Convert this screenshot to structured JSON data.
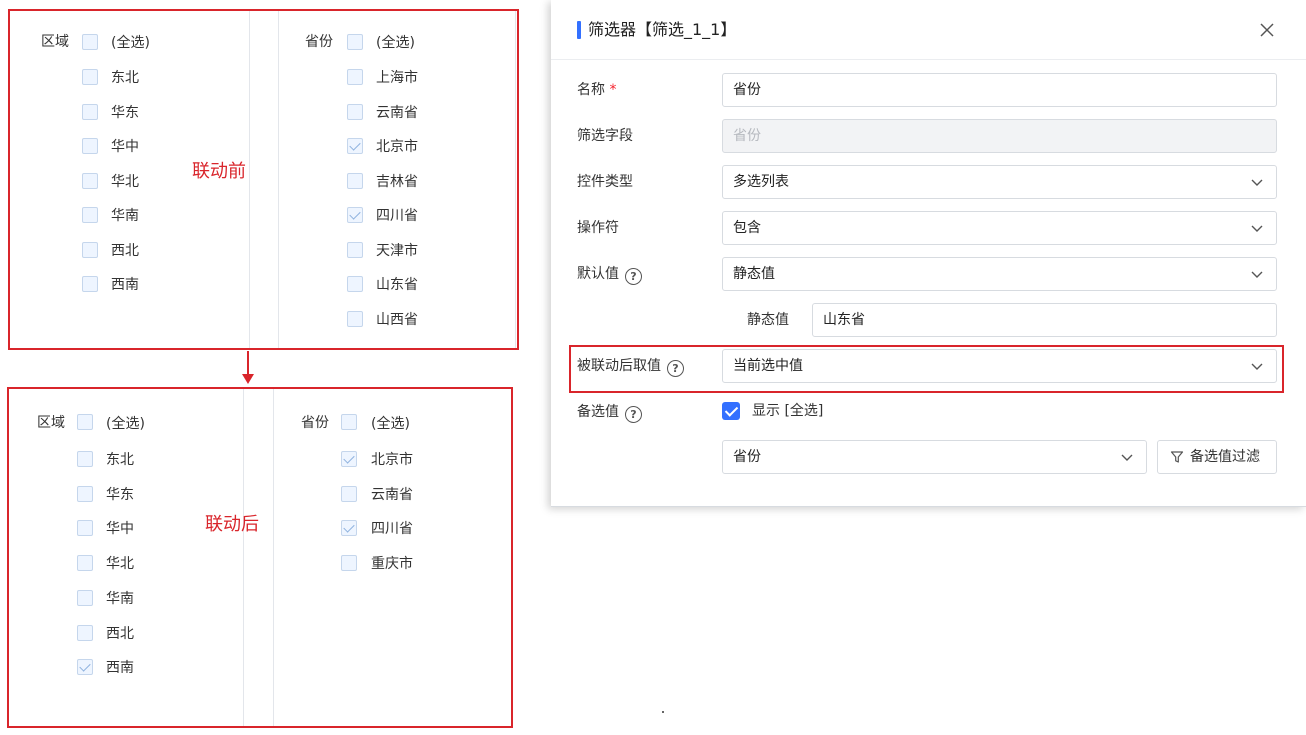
{
  "before": {
    "note": "联动前",
    "region": {
      "header": "区域",
      "select_all": "(全选)",
      "items": [
        {
          "label": "东北",
          "checked": false
        },
        {
          "label": "华东",
          "checked": false
        },
        {
          "label": "华中",
          "checked": false
        },
        {
          "label": "华北",
          "checked": false
        },
        {
          "label": "华南",
          "checked": false
        },
        {
          "label": "西北",
          "checked": false
        },
        {
          "label": "西南",
          "checked": false
        }
      ]
    },
    "province": {
      "header": "省份",
      "select_all": "(全选)",
      "items": [
        {
          "label": "上海市",
          "checked": false
        },
        {
          "label": "云南省",
          "checked": false
        },
        {
          "label": "北京市",
          "checked": true
        },
        {
          "label": "吉林省",
          "checked": false
        },
        {
          "label": "四川省",
          "checked": true
        },
        {
          "label": "天津市",
          "checked": false
        },
        {
          "label": "山东省",
          "checked": false
        },
        {
          "label": "山西省",
          "checked": false
        }
      ]
    }
  },
  "after": {
    "note": "联动后",
    "region": {
      "header": "区域",
      "select_all": "(全选)",
      "items": [
        {
          "label": "东北",
          "checked": false
        },
        {
          "label": "华东",
          "checked": false
        },
        {
          "label": "华中",
          "checked": false
        },
        {
          "label": "华北",
          "checked": false
        },
        {
          "label": "华南",
          "checked": false
        },
        {
          "label": "西北",
          "checked": false
        },
        {
          "label": "西南",
          "checked": true
        }
      ]
    },
    "province": {
      "header": "省份",
      "select_all": "(全选)",
      "items": [
        {
          "label": "北京市",
          "checked": true
        },
        {
          "label": "云南省",
          "checked": false
        },
        {
          "label": "四川省",
          "checked": true
        },
        {
          "label": "重庆市",
          "checked": false
        }
      ]
    }
  },
  "dialog": {
    "title": "筛选器【筛选_1_1】",
    "fields": {
      "name": {
        "label": "名称",
        "required_mark": "*",
        "value": "省份"
      },
      "filter_field": {
        "label": "筛选字段",
        "value": "省份"
      },
      "control_type": {
        "label": "控件类型",
        "value": "多选列表"
      },
      "operator": {
        "label": "操作符",
        "value": "包含"
      },
      "default_value": {
        "label": "默认值",
        "value": "静态值"
      },
      "static_value": {
        "label": "静态值",
        "value": "山东省"
      },
      "linked_value": {
        "label": "被联动后取值",
        "value": "当前选中值"
      },
      "options": {
        "label": "备选值",
        "show_all_label": "显示 [全选]",
        "show_all_checked": true,
        "field_value": "省份"
      }
    },
    "filter_button": "备选值过滤",
    "help_glyph": "?"
  },
  "colors": {
    "accent": "#3370ff",
    "annotation_red": "#d9252b",
    "checkbox_fill": "#eef5ff"
  }
}
